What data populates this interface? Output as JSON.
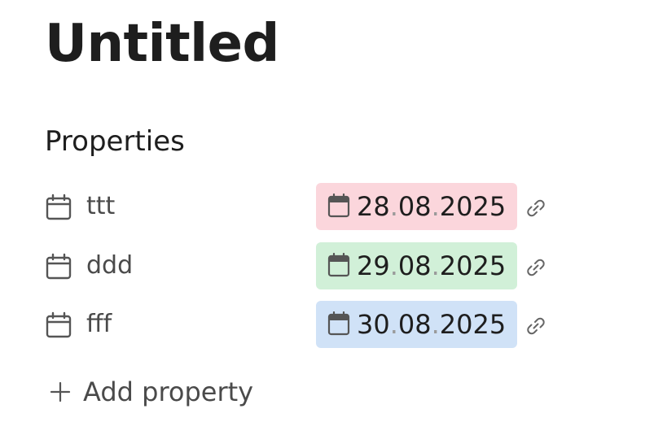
{
  "page": {
    "title": "Untitled"
  },
  "properties": {
    "heading": "Properties",
    "items": [
      {
        "name": "ttt",
        "icon": "calendar-icon",
        "date": {
          "day": "28",
          "month": "08",
          "year": "2025",
          "separator": "."
        },
        "chip_color": "#fbd6dc"
      },
      {
        "name": "ddd",
        "icon": "calendar-icon",
        "date": {
          "day": "29",
          "month": "08",
          "year": "2025",
          "separator": "."
        },
        "chip_color": "#d1f0d8"
      },
      {
        "name": "fff",
        "icon": "calendar-icon",
        "date": {
          "day": "30",
          "month": "08",
          "year": "2025",
          "separator": "."
        },
        "chip_color": "#d0e2f7"
      }
    ],
    "add_label": "Add property"
  }
}
